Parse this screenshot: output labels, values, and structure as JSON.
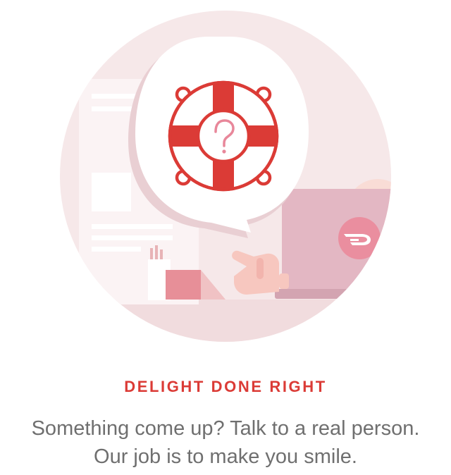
{
  "feature": {
    "heading": "DELIGHT DONE RIGHT",
    "body": "Something come up? Talk to a real person. Our job is to make you smile."
  },
  "illustration": {
    "icons": [
      "lifebuoy-icon",
      "question-mark-icon",
      "doordash-logo-icon",
      "laptop-icon",
      "pointing-hand-icon"
    ],
    "colors": {
      "brand_red": "#db3b36",
      "circle_bg": "#f5e7e8",
      "laptop": "#e3b7c2",
      "logo_badge": "#e8879a",
      "question_mark": "#e8879a"
    }
  }
}
